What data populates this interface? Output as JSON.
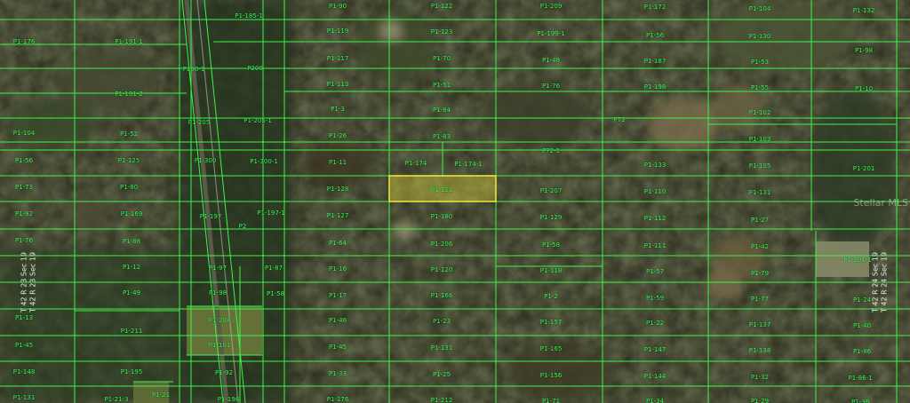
{
  "map": {
    "watermark": "Stellar MLS",
    "highlight_color": "#f2ea3a",
    "line_color": "#3df24a",
    "selected_parcel": "P1-121",
    "vertical_labels": {
      "left_1": "T 42 R 23 Sec 19",
      "left_2": "T 42 R 23 Sec 19",
      "right_1": "T 42 R 24 Sec 19",
      "right_2": "T 42 R 24 Sec 19"
    },
    "parcels": [
      {
        "id": "p001",
        "label": "P1-176"
      },
      {
        "id": "p002",
        "label": "P1-191-1"
      },
      {
        "id": "p003",
        "label": "P1-185-1"
      },
      {
        "id": "p004",
        "label": "P1-90"
      },
      {
        "id": "p005",
        "label": "P1-122"
      },
      {
        "id": "p006",
        "label": "P1-209"
      },
      {
        "id": "p007",
        "label": "P1-172"
      },
      {
        "id": "p008",
        "label": "P1-104"
      },
      {
        "id": "p009",
        "label": "P1-132"
      },
      {
        "id": "p010",
        "label": "P1-119"
      },
      {
        "id": "p011",
        "label": "P1-123"
      },
      {
        "id": "p012",
        "label": "P1-199-1"
      },
      {
        "id": "p013",
        "label": "P1-56"
      },
      {
        "id": "p014",
        "label": "P1-130"
      },
      {
        "id": "p015",
        "label": "P1-98"
      },
      {
        "id": "p016",
        "label": "P200-1"
      },
      {
        "id": "p017",
        "label": "P200"
      },
      {
        "id": "p018",
        "label": "P1-117"
      },
      {
        "id": "p019",
        "label": "P1-70"
      },
      {
        "id": "p020",
        "label": "P1-48"
      },
      {
        "id": "p021",
        "label": "P1-187"
      },
      {
        "id": "p022",
        "label": "P1-53"
      },
      {
        "id": "p023",
        "label": "P1-191-2"
      },
      {
        "id": "p024",
        "label": "P1-113"
      },
      {
        "id": "p025",
        "label": "P1-51"
      },
      {
        "id": "p026",
        "label": "P1-76"
      },
      {
        "id": "p027",
        "label": "P1-198"
      },
      {
        "id": "p028",
        "label": "P1-55"
      },
      {
        "id": "p029",
        "label": "P1-10"
      },
      {
        "id": "p030",
        "label": "P1-3"
      },
      {
        "id": "p031",
        "label": "P1-84"
      },
      {
        "id": "p032",
        "label": "P1-102"
      },
      {
        "id": "p033",
        "label": "P1-205"
      },
      {
        "id": "p034",
        "label": "P1-205-1"
      },
      {
        "id": "p035",
        "label": "P72"
      },
      {
        "id": "p036",
        "label": "P1-104"
      },
      {
        "id": "p037",
        "label": "P1-52"
      },
      {
        "id": "p038",
        "label": "P1-26"
      },
      {
        "id": "p039",
        "label": "P1-83"
      },
      {
        "id": "p040",
        "label": "P1-103"
      },
      {
        "id": "p041",
        "label": "P72-1"
      },
      {
        "id": "p042",
        "label": "P1-56"
      },
      {
        "id": "p043",
        "label": "P1-125"
      },
      {
        "id": "p044",
        "label": "P1-300"
      },
      {
        "id": "p045",
        "label": "P1-300-1"
      },
      {
        "id": "p046",
        "label": "P1-11"
      },
      {
        "id": "p047",
        "label": "P1-174"
      },
      {
        "id": "p048",
        "label": "P1-174-1"
      },
      {
        "id": "p049",
        "label": "P1-133"
      },
      {
        "id": "p050",
        "label": "P1-105"
      },
      {
        "id": "p051",
        "label": "P1-201"
      },
      {
        "id": "p052",
        "label": "P1-73"
      },
      {
        "id": "p053",
        "label": "P1-80"
      },
      {
        "id": "p054",
        "label": "P1-128"
      },
      {
        "id": "p055",
        "label": "P1-121"
      },
      {
        "id": "p056",
        "label": "P1-207"
      },
      {
        "id": "p057",
        "label": "P1-110"
      },
      {
        "id": "p058",
        "label": "P1-131"
      },
      {
        "id": "p059",
        "label": "P1-92"
      },
      {
        "id": "p060",
        "label": "P1-169"
      },
      {
        "id": "p061",
        "label": "P1-197"
      },
      {
        "id": "p062",
        "label": "P1-197-1"
      },
      {
        "id": "p063",
        "label": "P1-127"
      },
      {
        "id": "p064",
        "label": "P1-180"
      },
      {
        "id": "p065",
        "label": "P1-129"
      },
      {
        "id": "p066",
        "label": "P1-112"
      },
      {
        "id": "p067",
        "label": "P1-27"
      },
      {
        "id": "p068",
        "label": "P2"
      },
      {
        "id": "p069",
        "label": "P1-76"
      },
      {
        "id": "p070",
        "label": "P1-88"
      },
      {
        "id": "p071",
        "label": "P1-64"
      },
      {
        "id": "p072",
        "label": "P1-206"
      },
      {
        "id": "p073",
        "label": "P1-58"
      },
      {
        "id": "p074",
        "label": "P1-111"
      },
      {
        "id": "p075",
        "label": "P1-42"
      },
      {
        "id": "p076",
        "label": "P1-201-1"
      },
      {
        "id": "p077",
        "label": "P1-12"
      },
      {
        "id": "p078",
        "label": "P1-97"
      },
      {
        "id": "p079",
        "label": "P1-87"
      },
      {
        "id": "p080",
        "label": "P1-16"
      },
      {
        "id": "p081",
        "label": "P1-120"
      },
      {
        "id": "p082",
        "label": "P1-118"
      },
      {
        "id": "p083",
        "label": "P1-57"
      },
      {
        "id": "p084",
        "label": "P1-79"
      },
      {
        "id": "p085",
        "label": "P1-49"
      },
      {
        "id": "p086",
        "label": "P1-98"
      },
      {
        "id": "p087",
        "label": "P1-58"
      },
      {
        "id": "p088",
        "label": "P1-17"
      },
      {
        "id": "p089",
        "label": "P1-166"
      },
      {
        "id": "p090",
        "label": "P1-2"
      },
      {
        "id": "p091",
        "label": "P1-59"
      },
      {
        "id": "p092",
        "label": "P1-77"
      },
      {
        "id": "p093",
        "label": "P1-24"
      },
      {
        "id": "p094",
        "label": "P1-13"
      },
      {
        "id": "p095",
        "label": "P1-208"
      },
      {
        "id": "p096",
        "label": "P1-46"
      },
      {
        "id": "p097",
        "label": "P1-23"
      },
      {
        "id": "p098",
        "label": "P1-157"
      },
      {
        "id": "p099",
        "label": "P1-22"
      },
      {
        "id": "p100",
        "label": "P1-137"
      },
      {
        "id": "p101",
        "label": "P1-40"
      },
      {
        "id": "p102",
        "label": "P1-211"
      },
      {
        "id": "p103",
        "label": "P1-101"
      },
      {
        "id": "p104",
        "label": "P1-45"
      },
      {
        "id": "p105",
        "label": "P1-45"
      },
      {
        "id": "p106",
        "label": "P1-131"
      },
      {
        "id": "p107",
        "label": "P1-165"
      },
      {
        "id": "p108",
        "label": "P1-147"
      },
      {
        "id": "p109",
        "label": "P1-138"
      },
      {
        "id": "p110",
        "label": "P1-86"
      },
      {
        "id": "p111",
        "label": "P1-148"
      },
      {
        "id": "p112",
        "label": "P1-195"
      },
      {
        "id": "p113",
        "label": "P1-92"
      },
      {
        "id": "p114",
        "label": "P1-33"
      },
      {
        "id": "p115",
        "label": "P1-25"
      },
      {
        "id": "p116",
        "label": "P1-156"
      },
      {
        "id": "p117",
        "label": "P1-144"
      },
      {
        "id": "p118",
        "label": "P1-32"
      },
      {
        "id": "p119",
        "label": "P1-86-1"
      },
      {
        "id": "p120",
        "label": "P1-131"
      },
      {
        "id": "p121",
        "label": "P1-21-3"
      },
      {
        "id": "p122",
        "label": "P1-21"
      },
      {
        "id": "p123",
        "label": "P1-196"
      },
      {
        "id": "p124",
        "label": "P1-176"
      },
      {
        "id": "p125",
        "label": "P1-212"
      },
      {
        "id": "p126",
        "label": "P1-71"
      },
      {
        "id": "p127",
        "label": "P1-34"
      },
      {
        "id": "p128",
        "label": "P1-29"
      },
      {
        "id": "p129",
        "label": "P1-36"
      }
    ]
  }
}
